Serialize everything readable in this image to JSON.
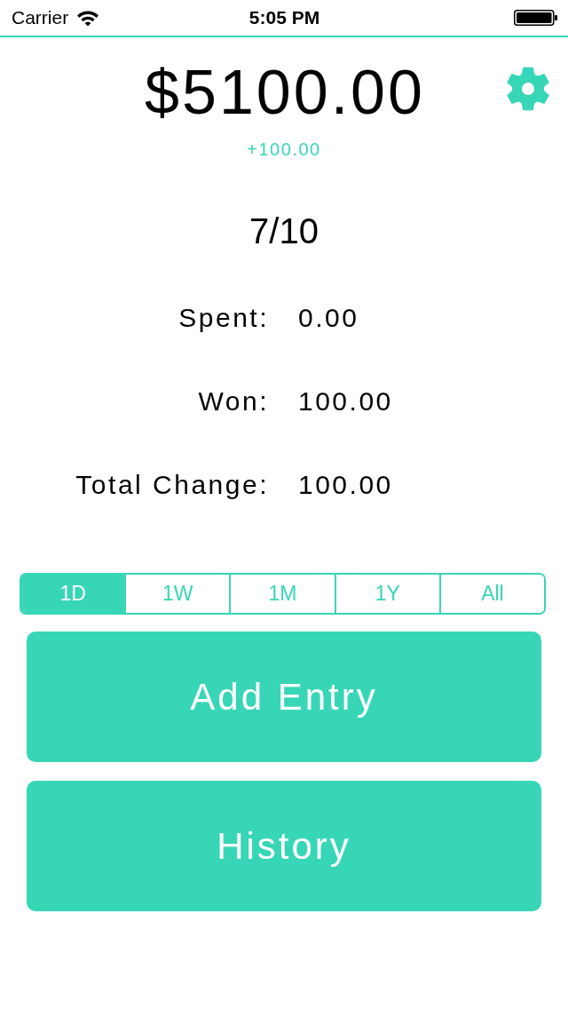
{
  "status_bar": {
    "carrier": "Carrier",
    "time": "5:05 PM"
  },
  "balance": {
    "amount": "$5100.00",
    "change": "+100.00"
  },
  "record": "7/10",
  "stats": [
    {
      "label": "Spent:",
      "value": "0.00"
    },
    {
      "label": "Won:",
      "value": "100.00"
    },
    {
      "label": "Total Change:",
      "value": "100.00"
    }
  ],
  "periods": [
    {
      "label": "1D",
      "selected": true
    },
    {
      "label": "1W",
      "selected": false
    },
    {
      "label": "1M",
      "selected": false
    },
    {
      "label": "1Y",
      "selected": false
    },
    {
      "label": "All",
      "selected": false
    }
  ],
  "buttons": [
    "Add Entry",
    "History"
  ]
}
